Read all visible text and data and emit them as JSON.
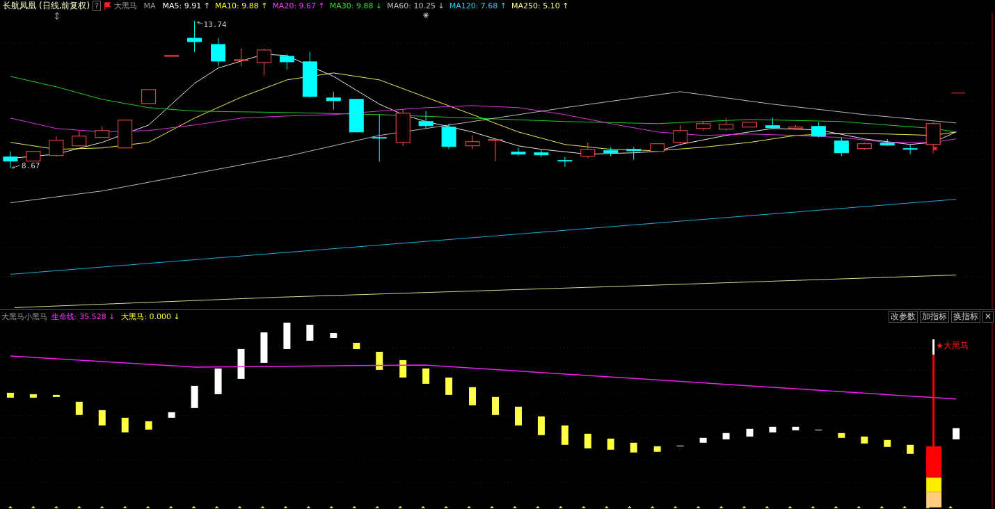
{
  "header": {
    "stock_name": "长航凤凰",
    "period": "(日线,前复权)",
    "help": "?",
    "indicator_name": "大黑马",
    "ma_label": "MA",
    "ma_items": [
      {
        "label": "MA5: 9.91",
        "arrow": "↑",
        "color": "#ffffff"
      },
      {
        "label": "MA10: 9.88",
        "arrow": "↑",
        "color": "#ffff33"
      },
      {
        "label": "MA20: 9.67",
        "arrow": "↑",
        "color": "#ff33ff"
      },
      {
        "label": "MA30: 9.88",
        "arrow": "↓",
        "color": "#33dd33"
      },
      {
        "label": "MA60: 10.25",
        "arrow": "↓",
        "color": "#c0c0c0"
      },
      {
        "label": "MA120: 7.68",
        "arrow": "↑",
        "color": "#33ccee"
      },
      {
        "label": "MA250: 5.10",
        "arrow": "↑",
        "color": "#ffff99"
      }
    ]
  },
  "price_chart": {
    "high_label": "13.74",
    "low_label": "8.67"
  },
  "indicator_panel": {
    "name": "大黑马小黑马",
    "values": [
      {
        "label": "生命线: 35.528",
        "arrow": "↓",
        "color": "#ff33ff"
      },
      {
        "label": "大黑马: 0.000",
        "arrow": "↓",
        "color": "#ffff33"
      }
    ],
    "buttons": [
      "改参数",
      "加指标",
      "换指标"
    ],
    "close": "✕",
    "signal_label": "★大黑马"
  }
}
